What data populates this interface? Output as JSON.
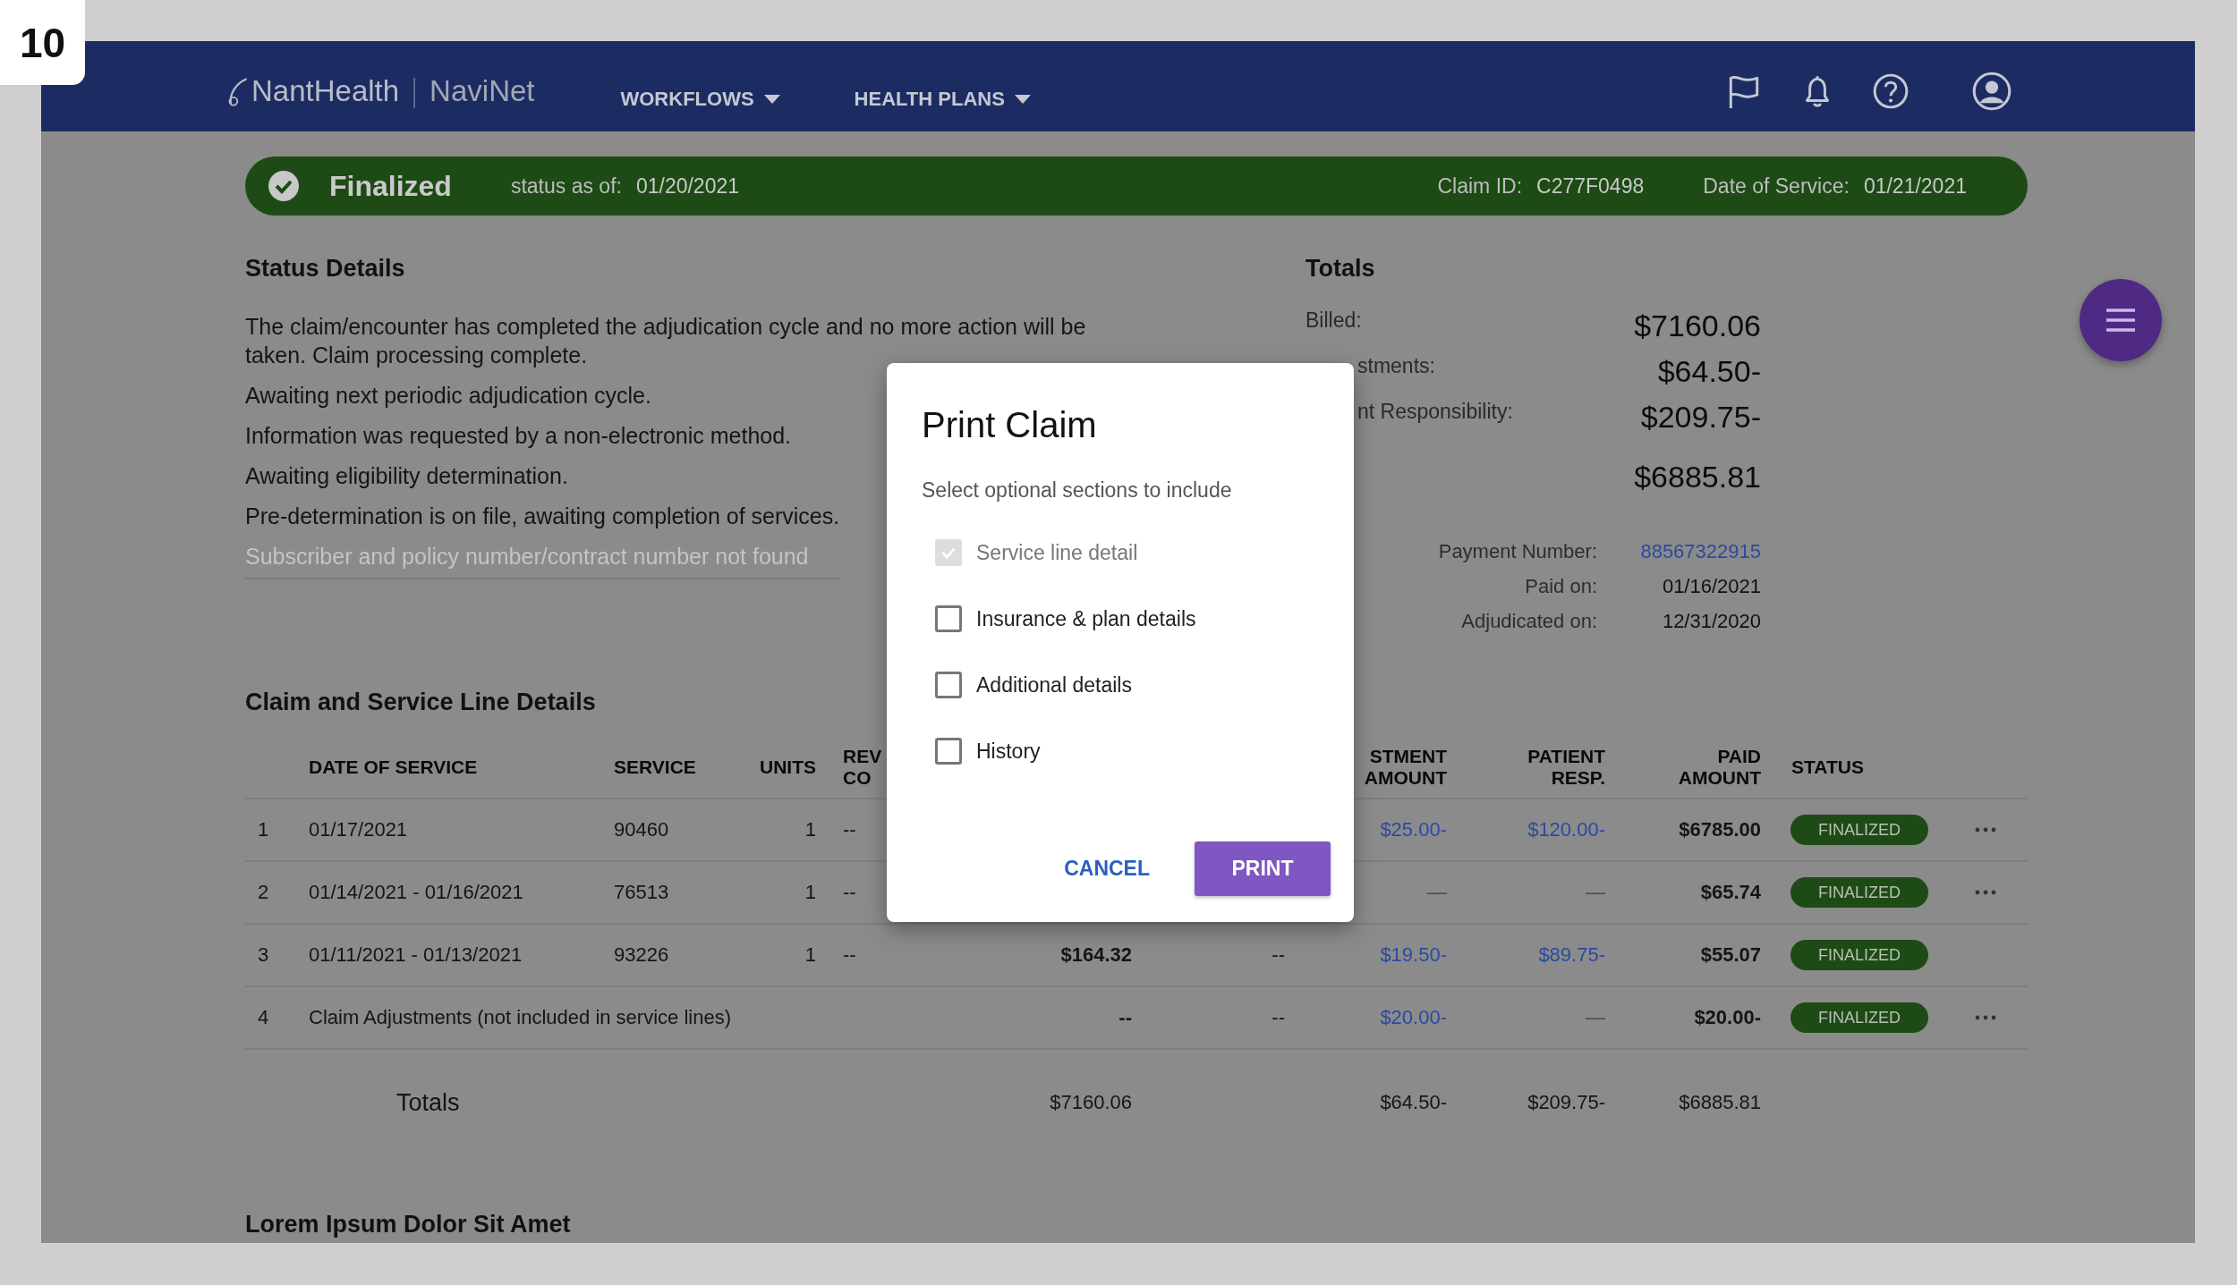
{
  "frame_badge": "10",
  "header": {
    "brand": "NantHealth",
    "product": "NaviNet",
    "nav": [
      {
        "label": "WORKFLOWS"
      },
      {
        "label": "HEALTH PLANS"
      }
    ]
  },
  "status_banner": {
    "status": "Finalized",
    "as_of_label": "status as of:",
    "as_of": "01/20/2021",
    "claim_id_label": "Claim ID:",
    "claim_id": "C277F0498",
    "service_date_label": "Date of Service:",
    "service_date": "01/21/2021"
  },
  "status_details": {
    "title": "Status Details",
    "messages": [
      {
        "text": "The claim/encounter has completed the adjudication cycle and no more action will be taken.  Claim  processing complete.",
        "faded": false
      },
      {
        "text": "Awaiting next periodic adjudication cycle.",
        "faded": false
      },
      {
        "text": "Information was requested by a non-electronic method.",
        "faded": false
      },
      {
        "text": "Awaiting eligibility determination.",
        "faded": false
      },
      {
        "text": "Pre-determination is on file, awaiting completion of services.",
        "faded": false
      },
      {
        "text": "Subscriber and policy number/contract number not found",
        "faded": true
      }
    ]
  },
  "totals": {
    "title": "Totals",
    "amounts": [
      {
        "label": "Billed:",
        "value": "$7160.06",
        "clipped": false
      },
      {
        "label": "stments:",
        "value": "$64.50-",
        "clipped": true
      },
      {
        "label": "nt Responsibility:",
        "value": "$209.75-",
        "clipped": true
      },
      {
        "value": "$6885.81"
      }
    ],
    "payment": [
      {
        "label": "Payment Number:",
        "value": "88567322915",
        "kind": "link"
      },
      {
        "label": "Paid on:",
        "value": "01/16/2021",
        "kind": "text"
      },
      {
        "label": "Adjudicated on:",
        "value": "12/31/2020",
        "kind": "text"
      }
    ]
  },
  "claim_lines": {
    "title": "Claim and Service Line Details",
    "columns": {
      "date_of_service": [
        "DATE OF SERVICE"
      ],
      "service": [
        "SERVICE"
      ],
      "units": [
        "UNITS"
      ],
      "rev_code": [
        "REV",
        "CO"
      ],
      "adjustment_amount": [
        "STMENT",
        "AMOUNT"
      ],
      "patient_resp": [
        "PATIENT",
        "RESP."
      ],
      "paid_amount": [
        "PAID",
        "AMOUNT"
      ],
      "status": [
        "STATUS"
      ]
    },
    "rows": [
      {
        "kind": "line",
        "number": "1",
        "date_of_service": "01/17/2021",
        "service": "90460",
        "units": "1",
        "rev_code": "--",
        "adjustment_amount": {
          "text": "$25.00-",
          "kind": "link"
        },
        "patient_resp": {
          "text": "$120.00-",
          "kind": "link"
        },
        "paid_amount": "$6785.00",
        "status": "FINALIZED",
        "has_menu": true
      },
      {
        "kind": "line",
        "number": "2",
        "date_of_service": "01/14/2021 - 01/16/2021",
        "service": "76513",
        "units": "1",
        "rev_code": "--",
        "adjustment_amount": {
          "text": "—",
          "kind": "faint"
        },
        "patient_resp": {
          "text": "—",
          "kind": "faint"
        },
        "paid_amount": "$65.74",
        "status": "FINALIZED",
        "has_menu": true
      },
      {
        "kind": "line",
        "number": "3",
        "date_of_service": "01/11/2021 - 01/13/2021",
        "service": "93226",
        "units": "1",
        "rev_code": "--",
        "column_6": "$164.32",
        "column_7": "--",
        "adjustment_amount": {
          "text": "$19.50-",
          "kind": "link"
        },
        "patient_resp": {
          "text": "$89.75-",
          "kind": "link"
        },
        "paid_amount": "$55.07",
        "status": "FINALIZED",
        "has_menu": false
      },
      {
        "kind": "adjustment",
        "number": "4",
        "description": "Claim Adjustments (not included in service lines)",
        "column_6": "--",
        "column_7": "--",
        "adjustment_amount": {
          "text": "$20.00-",
          "kind": "link"
        },
        "patient_resp": {
          "text": "—",
          "kind": "faint"
        },
        "paid_amount": "$20.00-",
        "status": "FINALIZED",
        "has_menu": true
      }
    ],
    "totals": {
      "label": "Totals",
      "column_6": "$7160.06",
      "adjustment_amount": "$64.50-",
      "patient_resp": "$209.75-",
      "paid_amount": "$6885.81"
    }
  },
  "next_section": {
    "title": "Lorem Ipsum Dolor Sit Amet"
  },
  "dialog": {
    "title": "Print Claim",
    "subtitle": "Select optional sections to include",
    "options": [
      {
        "label": "Service line detail",
        "checked": true,
        "disabled": true
      },
      {
        "label": "Insurance & plan details",
        "checked": false,
        "disabled": false
      },
      {
        "label": "Additional details",
        "checked": false,
        "disabled": false
      },
      {
        "label": "History",
        "checked": false,
        "disabled": false
      }
    ],
    "buttons": [
      {
        "label": "CANCEL",
        "kind": "text"
      },
      {
        "label": "PRINT",
        "kind": "primary"
      }
    ]
  }
}
